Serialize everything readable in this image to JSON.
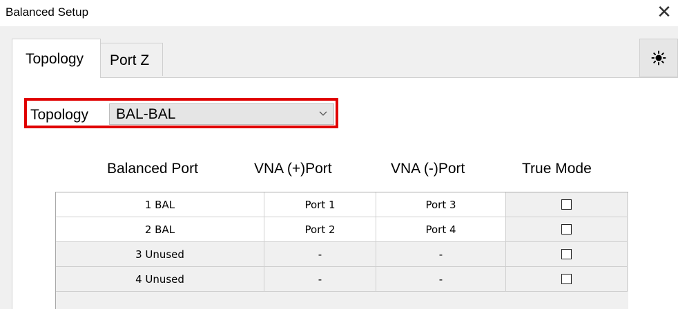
{
  "window": {
    "title": "Balanced Setup",
    "close_glyph": "✕"
  },
  "tabs": [
    {
      "label": "Topology",
      "selected": true
    },
    {
      "label": "Port Z",
      "selected": false
    }
  ],
  "side_button": {
    "icon": "sun-icon"
  },
  "topology": {
    "label": "Topology",
    "selected_value": "BAL-BAL"
  },
  "table": {
    "headers": [
      "Balanced Port",
      "VNA (+)Port",
      "VNA (-)Port",
      "True Mode"
    ],
    "rows": [
      {
        "balanced_port": "1 BAL",
        "vna_plus": "Port 1",
        "vna_minus": "Port 3",
        "true_mode": false
      },
      {
        "balanced_port": "2 BAL",
        "vna_plus": "Port 2",
        "vna_minus": "Port 4",
        "true_mode": false
      },
      {
        "balanced_port": "3 Unused",
        "vna_plus": "-",
        "vna_minus": "-",
        "true_mode": false
      },
      {
        "balanced_port": "4 Unused",
        "vna_plus": "-",
        "vna_minus": "-",
        "true_mode": false
      }
    ]
  },
  "colors": {
    "highlight": "#e00000"
  }
}
